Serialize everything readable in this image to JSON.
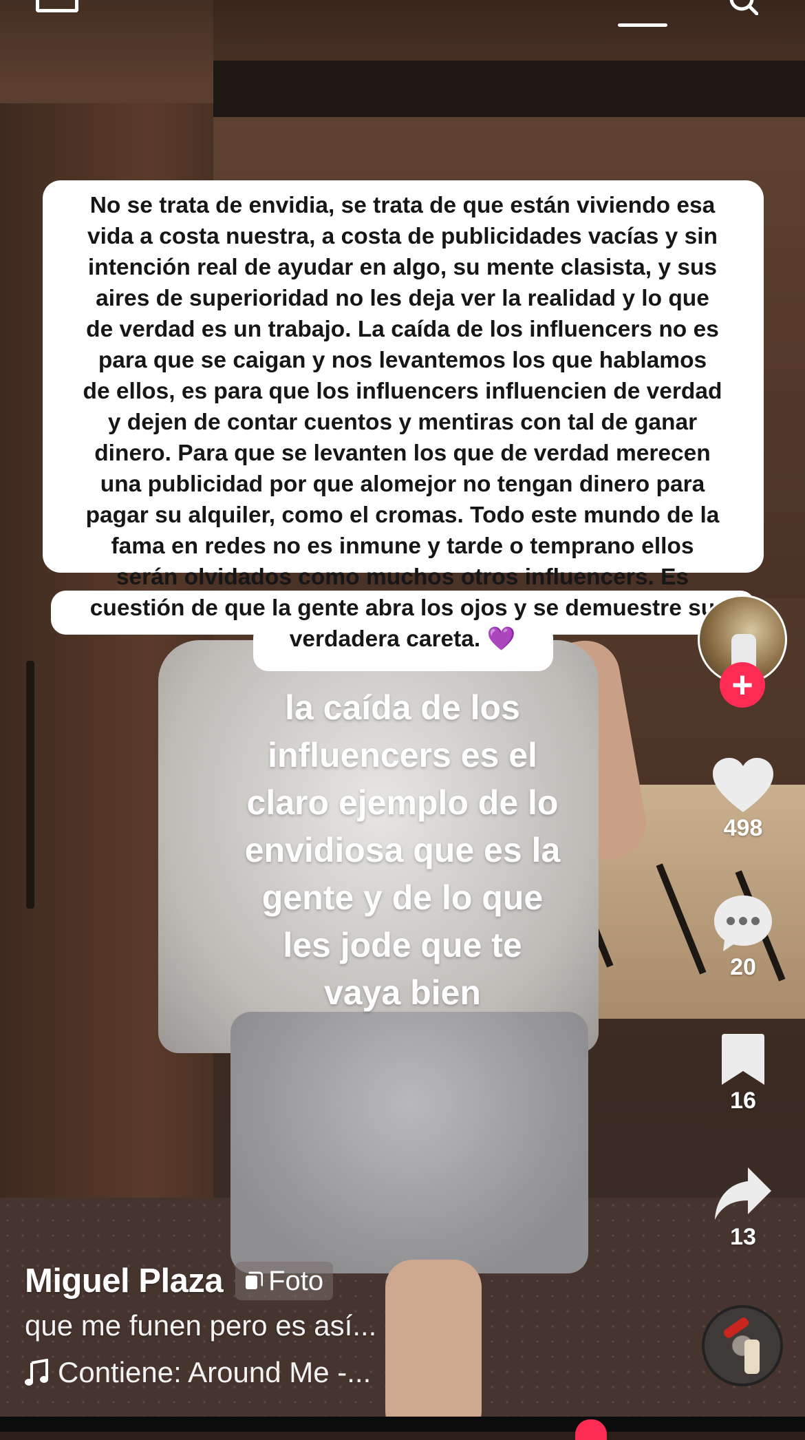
{
  "comment_bubble": {
    "lines": [
      "No se trata de envidia, se trata de que están viviendo esa",
      "vida a costa nuestra, a costa de publicidades vacías y sin",
      "intención real de ayudar en algo, su mente clasista, y sus",
      "aires de superioridad no les deja ver la realidad y lo que",
      "de verdad es un trabajo. La caída de los influencers no es",
      "para que se caigan y nos levantemos los que  hablamos",
      "de ellos, es para que los influencers influencien de verdad",
      "y dejen de contar cuentos y mentiras con tal de ganar",
      "dinero. Para que se levanten los que de verdad merecen",
      "una publicidad por que alomejor no tengan dinero para",
      "pagar su alquiler, como el cromas. Todo este mundo de la",
      "fama en redes no es inmune y tarde o temprano ellos",
      "serán olvidados como muchos otros influencers. Es",
      "cuestión de que la gente abra los ojos y se demuestre su",
      "verdadera careta. 💜"
    ]
  },
  "overlay_text": {
    "lines": [
      "la caída de los",
      "influencers es el",
      "claro ejemplo de lo",
      "envidiosa que es la",
      "gente y de lo que",
      "les jode que te",
      "vaya bien"
    ]
  },
  "sidebar": {
    "likes": "498",
    "comments": "20",
    "saves": "16",
    "shares": "13",
    "follow_symbol": "+"
  },
  "post": {
    "username": "Miguel Plaza",
    "badge": "Foto",
    "caption": "que me funen pero es así...",
    "music": "Contiene: Around Me -..."
  },
  "colors": {
    "accent": "#fe2c55",
    "bubble": "#ffffff",
    "heart_purple": "#9b59d0"
  }
}
